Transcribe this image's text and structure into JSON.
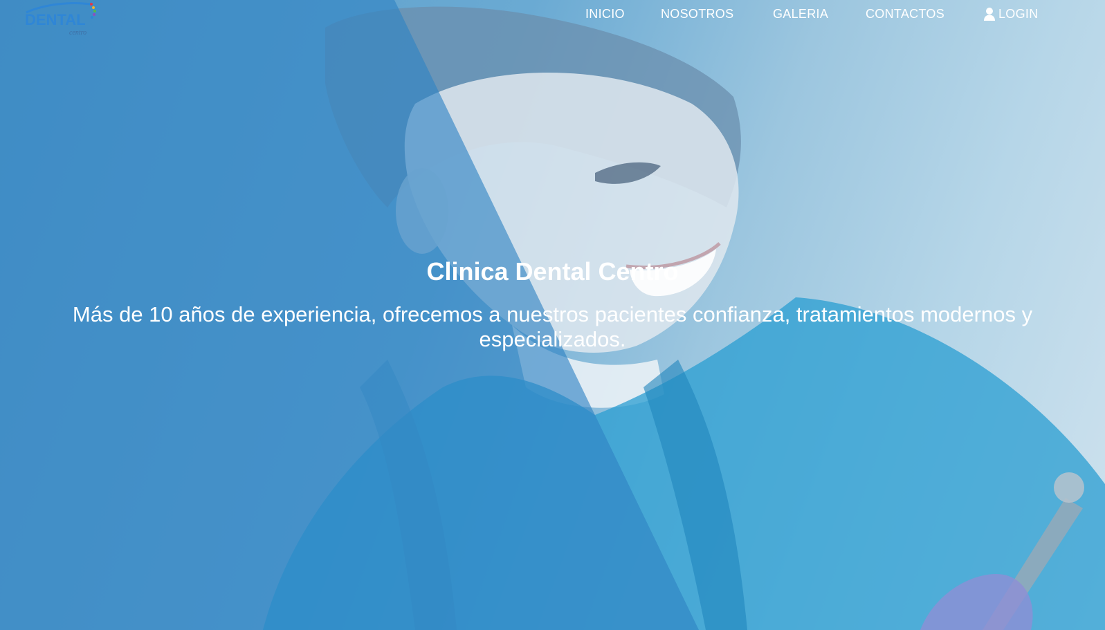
{
  "brand": {
    "logo_text": "DENTAL",
    "logo_sub": "centro",
    "colors": {
      "primary": "#2f86d6",
      "overlay": "#2e82c3",
      "text": "#ffffff"
    }
  },
  "nav": {
    "items": [
      {
        "label": "INICIO"
      },
      {
        "label": "NOSOTROS"
      },
      {
        "label": "GALERIA"
      },
      {
        "label": "CONTACTOS"
      }
    ],
    "login": {
      "label": "LOGIN",
      "icon": "user-icon"
    }
  },
  "hero": {
    "title": "Clinica Dental Centro",
    "subtitle": "Más de 10 años de experiencia, ofrecemos a nuestros pacientes confianza, tratamientos modernos y especializados."
  }
}
